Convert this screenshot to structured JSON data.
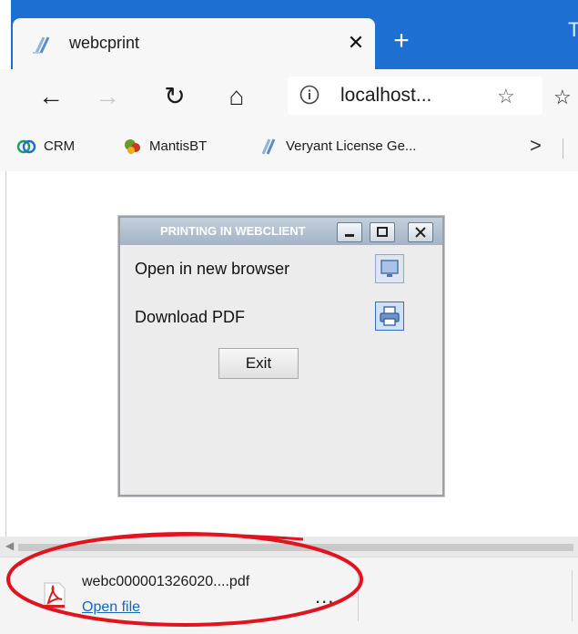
{
  "tab": {
    "title": "webcprint",
    "close_glyph": "✕",
    "new_tab_glyph": "+"
  },
  "toolbar": {
    "back_glyph": "←",
    "forward_glyph": "→",
    "refresh_glyph": "↻",
    "home_glyph": "⌂",
    "url": "localhost...",
    "star_glyph": "☆",
    "favorites_glyph": "☆"
  },
  "bookmarks": [
    {
      "label": "CRM",
      "icon": "crm-icon"
    },
    {
      "label": "MantisBT",
      "icon": "mantis-icon"
    },
    {
      "label": "Veryant License Ge...",
      "icon": "veryant-icon"
    }
  ],
  "bookmarks_more_glyph": ">",
  "dialog": {
    "title": "PRINTING IN WEBCLIENT",
    "option_browser": "Open in new browser",
    "option_pdf": "Download PDF",
    "exit_label": "Exit"
  },
  "download": {
    "filename": "webc000001326020....pdf",
    "open_label": "Open file",
    "more_glyph": "..."
  },
  "colors": {
    "tab_bar": "#1e6fd2",
    "highlight": "#e0141e",
    "link": "#1565c0"
  }
}
